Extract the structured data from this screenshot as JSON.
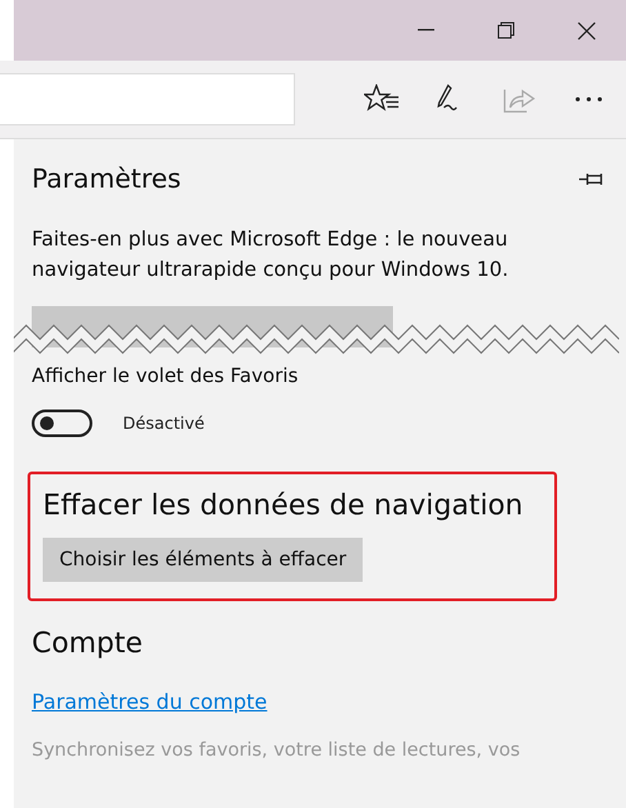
{
  "panel": {
    "title": "Paramètres",
    "promo": "Faites-en plus avec Microsoft Edge : le nouveau navigateur ultrarapide conçu pour Windows 10.",
    "favorites_bar": {
      "label": "Afficher le volet des Favoris",
      "on": false,
      "state_text": "Désactivé"
    },
    "clear_data": {
      "heading": "Effacer les données de navigation",
      "button": "Choisir les éléments à effacer",
      "highlighted": true
    },
    "account": {
      "heading": "Compte",
      "link": "Paramètres du compte",
      "sync_text": "Synchronisez vos favoris, votre liste de lectures, vos"
    }
  }
}
